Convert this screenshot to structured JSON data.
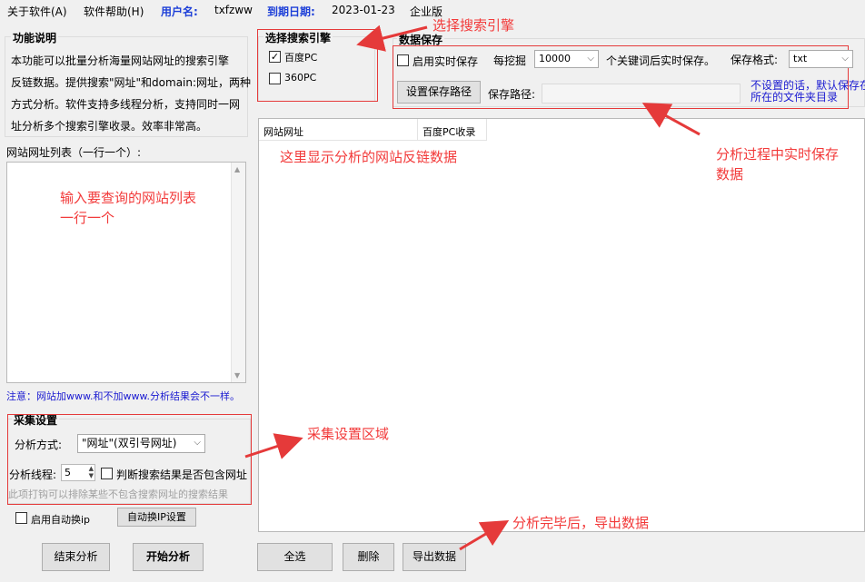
{
  "menubar": {
    "about": "关于软件(A)",
    "help": "软件帮助(H)",
    "user_label": "用户名:",
    "user_value": "txfzww",
    "expire_label": "到期日期:",
    "expire_value": "2023-01-23",
    "edition": "企业版"
  },
  "desc": {
    "title": "功能说明",
    "lines": [
      "本功能可以批量分析海量网站网址的搜索引擎",
      "反链数据。提供搜索\"网址\"和domain:网址，两种",
      "方式分析。软件支持多线程分析，支持同时一网",
      "址分析多个搜索引擎收录。效率非常高。"
    ]
  },
  "url_list": {
    "label": "网站网址列表（一行一个）:",
    "note": "注意：网站加www.和不加www.分析结果会不一样。"
  },
  "collect": {
    "title": "采集设置",
    "mode_label": "分析方式:",
    "mode_value": "\"网址\"(双引号网址)",
    "thread_label": "分析线程:",
    "thread_value": "5",
    "check_label": "判断搜索结果是否包含网址",
    "hint": "此项打钩可以排除某些不包含搜索网址的搜索结果"
  },
  "auto_ip": {
    "label": "启用自动换ip",
    "button": "自动换IP设置"
  },
  "buttons": {
    "stop": "结束分析",
    "start": "开始分析",
    "select_all": "全选",
    "delete": "删除",
    "export": "导出数据"
  },
  "engine": {
    "title": "选择搜索引擎",
    "baidu_pc": "百度PC",
    "s360_pc": "360PC",
    "baidu_checked": true,
    "s360_checked": false
  },
  "save": {
    "title": "数据保存",
    "realtime_label": "启用实时保存",
    "every_label": "每挖掘",
    "every_value": "10000",
    "after_label": "个关键词后实时保存。",
    "format_label": "保存格式:",
    "format_value": "txt",
    "path_button": "设置保存路径",
    "path_label": "保存路径:",
    "path_value": "",
    "default_note_1": "不设置的话，默认保存在",
    "default_note_2": "所在的文件夹目录"
  },
  "table": {
    "columns": [
      "网站网址",
      "百度PC收录"
    ]
  },
  "annotations": {
    "engine": "选择搜索引擎",
    "input_list_1": "输入要查询的网站列表",
    "input_list_2": "一行一个",
    "results": "这里显示分析的网站反链数据",
    "realtime_1": "分析过程中实时保存",
    "realtime_2": "数据",
    "collect_area": "采集设置区域",
    "export": "分析完毕后，导出数据"
  },
  "colors": {
    "annotation": "#f23a3a",
    "menu_label": "#1d3fd8",
    "note_blue": "#1b1bd1"
  }
}
